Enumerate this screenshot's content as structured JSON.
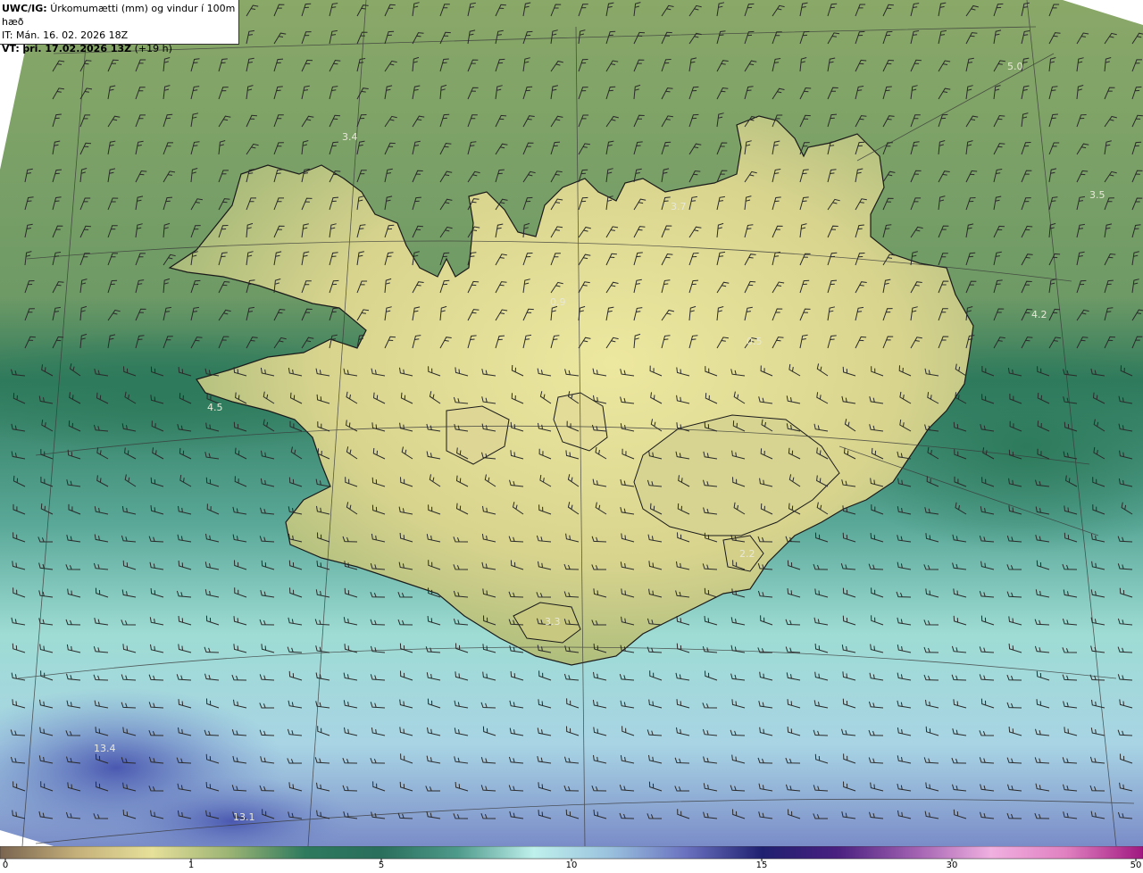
{
  "header": {
    "product": "UWC/IG:",
    "title": "Úrkomumætti (mm) og vindur í 100m hæð",
    "it_label": "IT:",
    "it_value": "Mán. 16. 02. 2026 18Z",
    "vt_label": "VT:",
    "vt_value": "þri. 17.02.2026 13Z",
    "vt_offset": "(+19 h)"
  },
  "value_labels": [
    {
      "text": "3.4"
    },
    {
      "text": "5.0"
    },
    {
      "text": "3.5"
    },
    {
      "text": "3.7"
    },
    {
      "text": "4.2"
    },
    {
      "text": "0.9"
    },
    {
      "text": "4.5"
    },
    {
      "text": "0.5"
    },
    {
      "text": "2.2"
    },
    {
      "text": "3.3"
    },
    {
      "text": "13.4"
    },
    {
      "text": "13.1"
    }
  ],
  "colorbar": {
    "ticks": [
      "0",
      "1",
      "5",
      "10",
      "15",
      "30",
      "50"
    ],
    "colors": [
      "#7a6450",
      "#c4b07a",
      "#e6e09a",
      "#9cb474",
      "#2e7a5e",
      "#2a6e5c",
      "#4e9a8a",
      "#bff0ec",
      "#9ac2de",
      "#6a72c0",
      "#202070",
      "#4a2080",
      "#a060b0",
      "#f0b0e0",
      "#e080c0",
      "#a01880"
    ]
  }
}
